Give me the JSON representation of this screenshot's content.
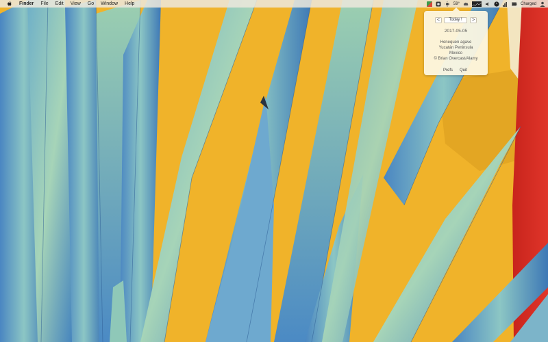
{
  "menubar": {
    "app": "Finder",
    "items": [
      "File",
      "Edit",
      "View",
      "Go",
      "Window",
      "Help"
    ],
    "status": {
      "temperature": "59°",
      "battery_label": "Charged"
    }
  },
  "popover": {
    "prev_symbol": "<",
    "today_label": "Today !",
    "next_symbol": ">",
    "date": "2017-05-05",
    "caption": {
      "line1": "Henequen agave",
      "line2": "Yucatán Peninsula",
      "line3": "Mexico",
      "line4": "© Brian Overcast/Alamy"
    },
    "prefs_label": "Prefs",
    "quit_label": "Quit"
  },
  "colors": {
    "wall_yellow": "#f0b32a",
    "wall_red": "#d8261f",
    "agave_blue": "#5d9ccc",
    "agave_teal": "#8fc1b6",
    "menubar_bg": "#ece8dc"
  }
}
